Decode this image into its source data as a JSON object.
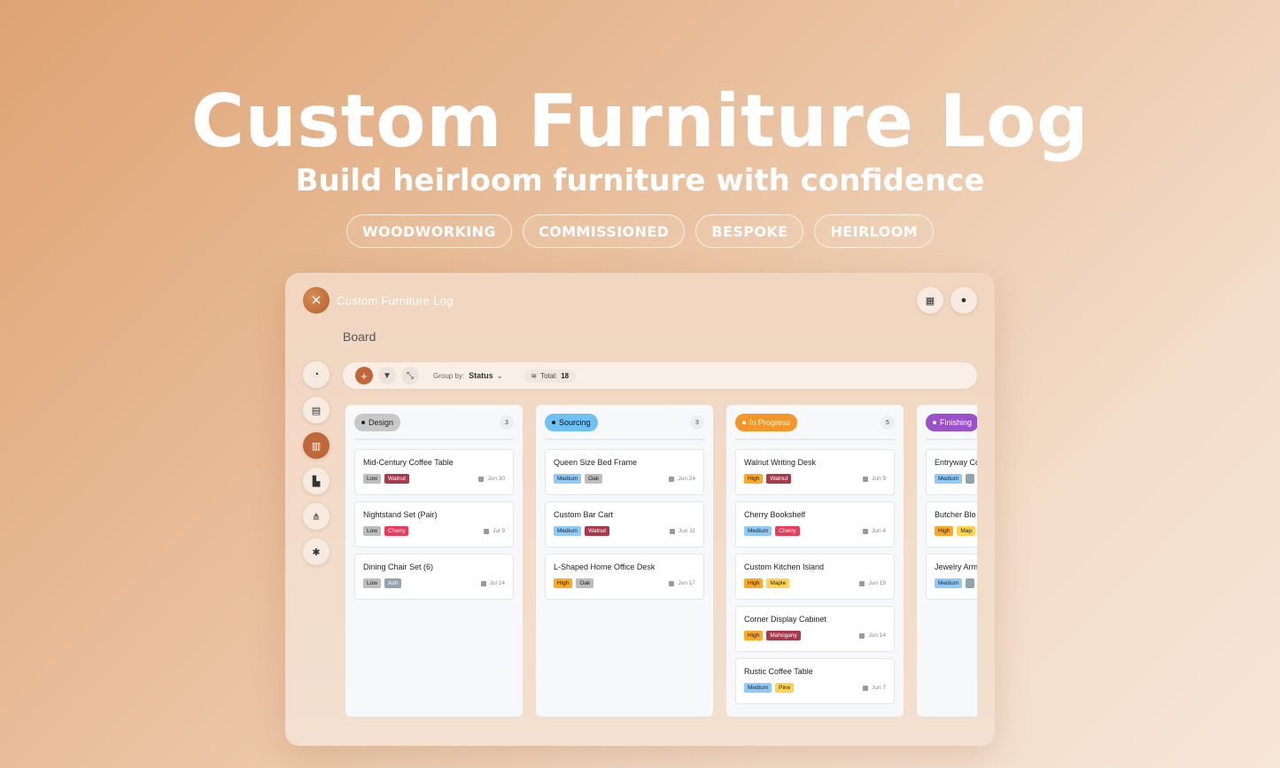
{
  "hero": {
    "title": "Custom Furniture Log",
    "subtitle": "Build heirloom furniture with confidence",
    "tags": [
      "WOODWORKING",
      "COMMISSIONED",
      "BESPOKE",
      "HEIRLOOM"
    ]
  },
  "app": {
    "title": "Custom Furniture Log",
    "page": "Board",
    "toolbar": {
      "group_by_label": "Group by:",
      "group_by_value": "Status",
      "total_label": "Total:",
      "total_value": "18"
    }
  },
  "colors": {
    "accent": "#c0673a",
    "priority_low": "#bdbdbd",
    "priority_medium": "#90caf9",
    "priority_high": "#ffa726",
    "wood_walnut": "#a83a4c",
    "wood_cherry": "#ee3a5a",
    "wood_oak": "#bdbdbd",
    "wood_ash": "#90a4ae",
    "wood_maple": "#ffd54f",
    "wood_mahogany": "#a83a4c",
    "wood_pine": "#ffd54f"
  },
  "columns": [
    {
      "name": "Design",
      "count": "3",
      "color": "#c8c8c8",
      "cards": [
        {
          "title": "Mid-Century Coffee Table",
          "priority": "Low",
          "wood": "Walnut",
          "date": "Jun 30"
        },
        {
          "title": "Nightstand Set (Pair)",
          "priority": "Low",
          "wood": "Cherry",
          "date": "Jul 9"
        },
        {
          "title": "Dining Chair Set (6)",
          "priority": "Low",
          "wood": "Ash",
          "date": "Jul 24"
        }
      ]
    },
    {
      "name": "Sourcing",
      "count": "3",
      "color": "#6ec1f2",
      "cards": [
        {
          "title": "Queen Size Bed Frame",
          "priority": "Medium",
          "wood": "Oak",
          "date": "Jun 24"
        },
        {
          "title": "Custom Bar Cart",
          "priority": "Medium",
          "wood": "Walnut",
          "date": "Jun 11"
        },
        {
          "title": "L-Shaped Home Office Desk",
          "priority": "High",
          "wood": "Oak",
          "date": "Jun 17"
        }
      ]
    },
    {
      "name": "In Progress",
      "count": "5",
      "color": "#f5962a",
      "cards": [
        {
          "title": "Walnut Writing Desk",
          "priority": "High",
          "wood": "Walnut",
          "date": "Jun 9"
        },
        {
          "title": "Cherry Bookshelf",
          "priority": "Medium",
          "wood": "Cherry",
          "date": "Jun 4"
        },
        {
          "title": "Custom Kitchen Island",
          "priority": "High",
          "wood": "Maple",
          "date": "Jun 19"
        },
        {
          "title": "Corner Display Cabinet",
          "priority": "High",
          "wood": "Mahogany",
          "date": "Jun 14"
        },
        {
          "title": "Rustic Coffee Table",
          "priority": "Medium",
          "wood": "Pine",
          "date": "Jun 7"
        }
      ]
    },
    {
      "name": "Finishing",
      "count": "",
      "color": "#9b51c9",
      "cards": [
        {
          "title": "Entryway Co",
          "priority": "Medium",
          "wood": "",
          "date": ""
        },
        {
          "title": "Butcher Blo",
          "priority": "High",
          "wood": "Map",
          "date": ""
        },
        {
          "title": "Jewelry Arm",
          "priority": "Medium",
          "wood": "",
          "date": ""
        }
      ]
    }
  ]
}
